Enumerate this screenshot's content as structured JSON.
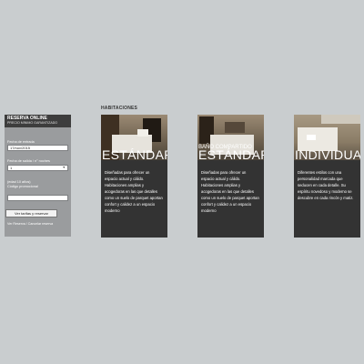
{
  "booking": {
    "title": "RESERVA ONLINE",
    "subtitle": "PRECIO MÍNIMO GARANTIZADO",
    "arrival_label": "Fecha de entrada",
    "arrival_value": "17/nov/2015",
    "nights_label": "Fecha de salida / n° noches",
    "nights_value": "1",
    "children_label": "(edad 10 años)",
    "promo_label": "Código promocional",
    "promo_value": "",
    "submit_label": "Ver tarifas y reservar",
    "links_text": "Ver Reserva / Cancelar reserva"
  },
  "rooms": {
    "section_title": "HABITACIONES",
    "items": [
      {
        "name": "ESTÁNDAR",
        "subname": "",
        "description": "Diseñadas para ofrecer un espacio actual y cálido. Habitaciones amplias y acogedoras en las que detalles como un suelo de parquet aportan confort y calidez a un espacio moderno"
      },
      {
        "name": "ESTÁNDAR",
        "subname": "BAÑO COMPARTIDO",
        "description": "Diseñadas para ofrecer un espacio actual y cálido. Habitaciones amplias y acogedoras en las que detalles como un suelo de parquet aportan confort y calidez a un espacio moderno"
      },
      {
        "name": "INDIVIDUAL",
        "subname": "",
        "description": "Diferentes estilos con una personalidad marcada que seducen en cada detalle. Su espíritu novedoso y moderno se descubre en cada rincón y matiz."
      }
    ]
  }
}
